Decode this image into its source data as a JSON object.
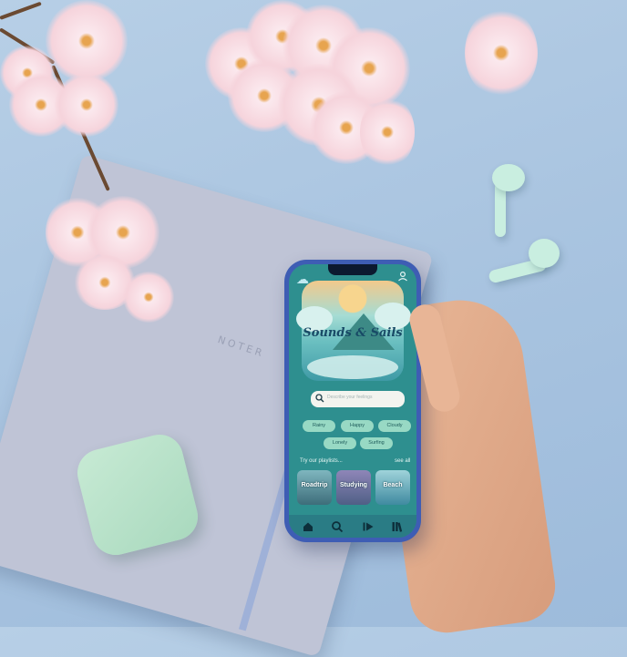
{
  "scene": {
    "notebook_label": "NOTER",
    "colors": {
      "background": "#a9c4e0",
      "notebook": "#bfc4d6",
      "earbuds": "#c9eee0",
      "phone_frame": "#3e5db4"
    }
  },
  "app": {
    "title": "Sounds & Sails",
    "logo_icon": "cloud-icon",
    "profile_icon": "user-icon",
    "search": {
      "placeholder": "Describe your feelings"
    },
    "chips": [
      {
        "label": "Rainy"
      },
      {
        "label": "Happy"
      },
      {
        "label": "Cloudy"
      },
      {
        "label": "Lonely"
      },
      {
        "label": "Surfing"
      }
    ],
    "playlists": {
      "heading": "Try our playlists...",
      "see_all": "see all",
      "items": [
        {
          "label": "Roadtrip",
          "color": "#3d6d7a"
        },
        {
          "label": "Studying",
          "color": "#4f5f86"
        },
        {
          "label": "Beach",
          "color": "#3f8aa0"
        }
      ]
    },
    "nav": [
      {
        "icon": "home-icon"
      },
      {
        "icon": "search-icon"
      },
      {
        "icon": "play-icon"
      },
      {
        "icon": "library-icon"
      }
    ],
    "colors": {
      "screen": "#2e8f8f",
      "chip": "#98d9c4",
      "navbar": "#2a7c85",
      "title": "#184a66"
    }
  }
}
